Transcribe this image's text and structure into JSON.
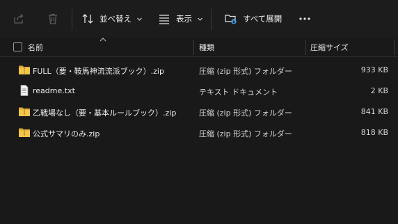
{
  "toolbar": {
    "sort_label": "並べ替え",
    "view_label": "表示",
    "expand_label": "すべて展開"
  },
  "columns": {
    "name": "名前",
    "type": "種類",
    "size": "圧縮サイズ"
  },
  "files": [
    {
      "name": "FULL（要・鞍馬神流流派ブック）.zip",
      "type": "圧縮 (zip 形式) フォルダー",
      "size": "933 KB",
      "icon": "zip-folder-icon"
    },
    {
      "name": "readme.txt",
      "type": "テキスト ドキュメント",
      "size": "2 KB",
      "icon": "text-document-icon"
    },
    {
      "name": "乙戦場なし（要・基本ルールブック）.zip",
      "type": "圧縮 (zip 形式) フォルダー",
      "size": "841 KB",
      "icon": "zip-folder-icon"
    },
    {
      "name": "公式サマリのみ.zip",
      "type": "圧縮 (zip 形式) フォルダー",
      "size": "818 KB",
      "icon": "zip-folder-icon"
    }
  ],
  "colors": {
    "background": "#191919",
    "folder": "#f3c64a",
    "accent": "#4aa3f0"
  }
}
